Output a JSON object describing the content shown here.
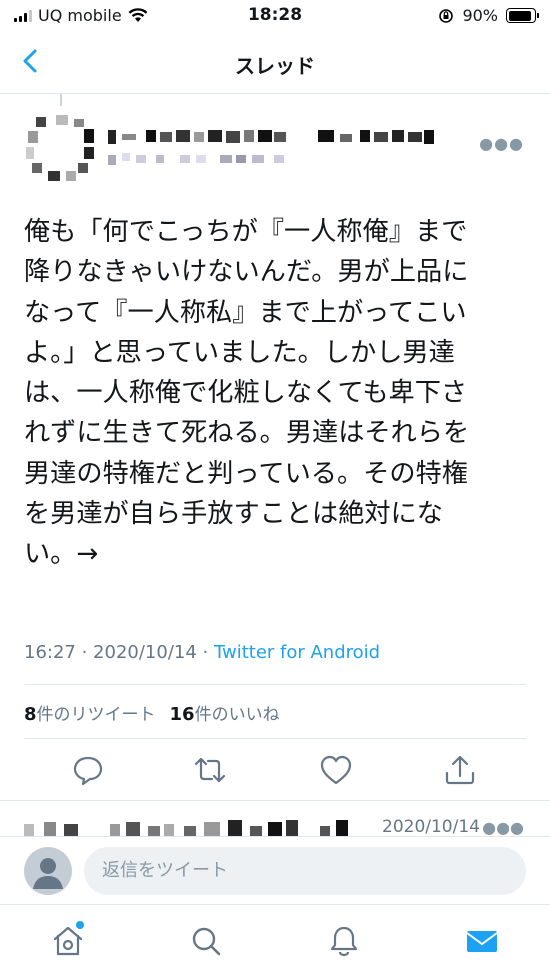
{
  "status_bar": {
    "carrier": "UQ mobile",
    "time": "18:28",
    "battery": "90%",
    "battery_level": 0.9
  },
  "nav": {
    "title": "スレッド"
  },
  "tweet": {
    "text": "俺も「何でこっちが『一人称俺』まで\n降りなきゃいけないんだ。男が上品に\nなって『一人称私』まで上がってこい\nよ。」と思っていました。しかし男達\nは、一人称俺で化粧しなくても卑下さ\nれずに生きて死ねる。男達はそれらを\n男達の特権だと判っている。その特権\nを男達が自ら手放すことは絶対にな\nい。→",
    "time": "16:27",
    "date": "2020/10/14",
    "separator": " · ",
    "client": "Twitter for Android",
    "retweet_count": "8",
    "retweet_label": "件のリツイート",
    "like_count": "16",
    "like_label": "件のいいね"
  },
  "next_tweet": {
    "date": "2020/10/14"
  },
  "reply": {
    "placeholder": "返信をツイート"
  },
  "colors": {
    "accent": "#1da1f2",
    "secondary_text": "#657786",
    "divider": "#e1e8ed"
  },
  "icons": {
    "back": "chevron-left-icon",
    "more": "more-dots-icon",
    "reply": "reply-icon",
    "retweet": "retweet-icon",
    "like": "heart-icon",
    "share": "share-icon",
    "home": "home-icon",
    "search": "search-icon",
    "notifications": "bell-icon",
    "messages": "mail-icon"
  }
}
